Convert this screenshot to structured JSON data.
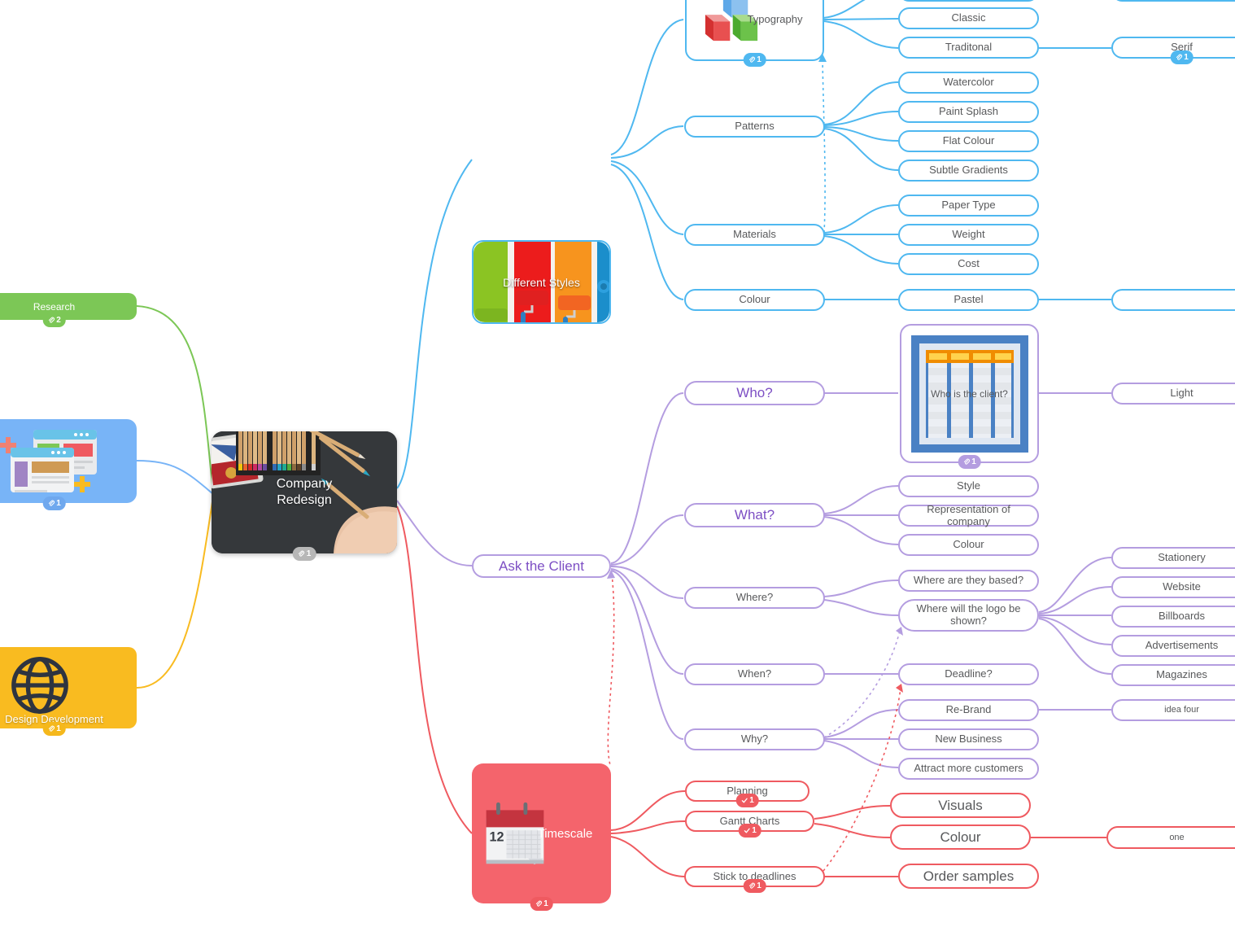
{
  "document": {
    "type": "mind-map",
    "title": "Company Redesign"
  },
  "central": {
    "label": "Company\nRedesign",
    "label_line1": "Company",
    "label_line2": "Redesign",
    "badge": {
      "icon": "attachment-icon",
      "count": "1",
      "color": "#b7b7b7"
    }
  },
  "branches": [
    {
      "id": "research",
      "label": "Research",
      "color": "#7cc756",
      "badge": {
        "icon": "attachment-icon",
        "count": "2"
      }
    },
    {
      "id": "wireframes",
      "label": "",
      "color": "#78b4f7",
      "badge": {
        "icon": "attachment-icon",
        "count": "1"
      }
    },
    {
      "id": "design-development",
      "label": "Design Development",
      "color": "#f9bb20",
      "badge": {
        "icon": "attachment-icon",
        "count": "1"
      }
    },
    {
      "id": "different-styles",
      "label": "Different Styles",
      "color": "#4fb8f0",
      "badge": null
    },
    {
      "id": "ask-the-client",
      "label": "Ask the Client",
      "color": "#b49de0",
      "badge": null
    },
    {
      "id": "timescale",
      "label": "Timescale",
      "color": "#f4646c",
      "badge": {
        "icon": "attachment-icon",
        "count": "1"
      }
    }
  ],
  "styles_branch": {
    "typography": {
      "label": "Typography",
      "badge": {
        "icon": "attachment-icon",
        "count": "1"
      },
      "children": [
        {
          "label": ""
        },
        {
          "label": "Classic"
        },
        {
          "label": "Traditonal",
          "children": [
            {
              "label": "Serif",
              "badge": {
                "icon": "attachment-icon",
                "count": "1"
              }
            }
          ]
        }
      ]
    },
    "patterns": {
      "label": "Patterns",
      "children": [
        {
          "label": "Watercolor"
        },
        {
          "label": "Paint Splash"
        },
        {
          "label": "Flat Colour"
        },
        {
          "label": "Subtle Gradients"
        }
      ]
    },
    "materials": {
      "label": "Materials",
      "children": [
        {
          "label": "Paper Type"
        },
        {
          "label": "Weight"
        },
        {
          "label": "Cost"
        }
      ]
    },
    "colour": {
      "label": "Colour",
      "children": [
        {
          "label": "Pastel",
          "children": [
            {
              "label": ""
            }
          ]
        }
      ]
    }
  },
  "client_branch": {
    "label": "Ask the Client",
    "who": {
      "label": "Who?",
      "children": [
        {
          "label": "Who is the client?",
          "badge": {
            "icon": "attachment-icon",
            "count": "1"
          },
          "children": [
            {
              "label": "Light"
            }
          ]
        }
      ]
    },
    "what": {
      "label": "What?",
      "children": [
        {
          "label": "Style"
        },
        {
          "label": "Representation of company"
        },
        {
          "label": "Colour"
        }
      ]
    },
    "where": {
      "label": "Where?",
      "children": [
        {
          "label": "Where are they based?"
        },
        {
          "label": "Where will the logo be shown?",
          "children": [
            {
              "label": "Stationery"
            },
            {
              "label": "Website"
            },
            {
              "label": "Billboards"
            },
            {
              "label": "Advertisements"
            },
            {
              "label": "Magazines"
            }
          ]
        }
      ]
    },
    "when": {
      "label": "When?",
      "children": [
        {
          "label": "Deadline?"
        }
      ]
    },
    "why": {
      "label": "Why?",
      "children": [
        {
          "label": "Re-Brand",
          "children": [
            {
              "label": "idea four"
            }
          ]
        },
        {
          "label": "New Business"
        },
        {
          "label": "Attract more customers"
        }
      ]
    }
  },
  "timescale_branch": {
    "label": "Timescale",
    "children": [
      {
        "label": "Planning",
        "badge": {
          "icon": "check-icon",
          "count": "1"
        }
      },
      {
        "label": "Gantt Charts",
        "badge": {
          "icon": "check-icon",
          "count": "1"
        },
        "children": [
          {
            "label": "Visuals"
          },
          {
            "label": "Colour",
            "children": [
              {
                "label": "one"
              }
            ]
          }
        ]
      },
      {
        "label": "Stick to deadlines",
        "badge": {
          "icon": "attachment-icon",
          "count": "1"
        },
        "children": [
          {
            "label": "Order samples"
          }
        ]
      }
    ]
  },
  "colors": {
    "blue": "#4fb8f0",
    "purple": "#b49de0",
    "red": "#ef5a60",
    "green": "#7cc756",
    "yellow": "#f9bb20",
    "lightblue": "#78b4f7",
    "text": "#58595b",
    "purple_label": "#7d4fc4"
  }
}
